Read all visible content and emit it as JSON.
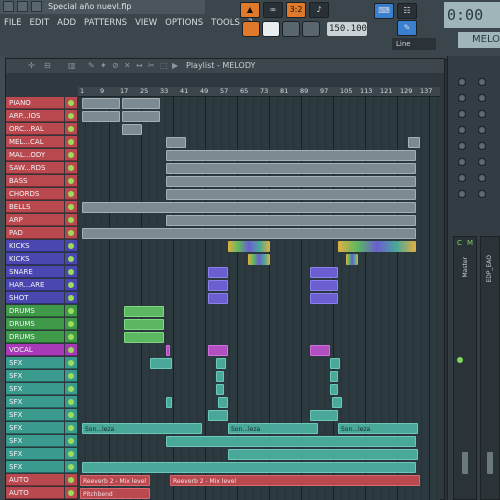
{
  "window": {
    "title": "Special año nuevl.flp"
  },
  "menu": [
    "FILE",
    "EDIT",
    "ADD",
    "PATTERNS",
    "VIEW",
    "OPTIONS",
    "TOOLS",
    "?"
  ],
  "transport": {
    "pattern_label": "PAT",
    "song_label": "SONG",
    "tempo": "150.100",
    "time": "0:00",
    "snap": "Line",
    "pattern_name": "MELO"
  },
  "playlist": {
    "title": "Playlist - MELODY",
    "ruler": [
      "1",
      "9",
      "17",
      "25",
      "33",
      "41",
      "49",
      "57",
      "65",
      "73",
      "81",
      "89",
      "97",
      "105",
      "113",
      "121",
      "129",
      "137"
    ]
  },
  "tracks": [
    {
      "name": "PIANO",
      "color": "#b9484f"
    },
    {
      "name": "ARP...IOS",
      "color": "#b9484f"
    },
    {
      "name": "ORC...RAL",
      "color": "#b9484f"
    },
    {
      "name": "MEL...CAL",
      "color": "#b9484f"
    },
    {
      "name": "MAL...ODY",
      "color": "#b9484f"
    },
    {
      "name": "SAW...RDS",
      "color": "#b9484f"
    },
    {
      "name": "BASS",
      "color": "#b9484f"
    },
    {
      "name": "CHORDS",
      "color": "#b9484f"
    },
    {
      "name": "BELLS",
      "color": "#b9484f"
    },
    {
      "name": "ARP",
      "color": "#b9484f"
    },
    {
      "name": "PAD",
      "color": "#b9484f"
    },
    {
      "name": "KICKS",
      "color": "#4a47b0"
    },
    {
      "name": "KICKS",
      "color": "#4a47b0"
    },
    {
      "name": "SNARE",
      "color": "#4a47b0"
    },
    {
      "name": "HAR...ARE",
      "color": "#4a47b0"
    },
    {
      "name": "SHOT",
      "color": "#4a47b0"
    },
    {
      "name": "DRUMS",
      "color": "#3e9a48"
    },
    {
      "name": "DRUMS",
      "color": "#3e9a48"
    },
    {
      "name": "DRUMS",
      "color": "#3e9a48"
    },
    {
      "name": "VOCAL",
      "color": "#a83ab8"
    },
    {
      "name": "SFX",
      "color": "#3a9a8e"
    },
    {
      "name": "SFX",
      "color": "#3a9a8e"
    },
    {
      "name": "SFX",
      "color": "#3a9a8e"
    },
    {
      "name": "SFX",
      "color": "#3a9a8e"
    },
    {
      "name": "SFX",
      "color": "#3a9a8e"
    },
    {
      "name": "SFX",
      "color": "#3a9a8e"
    },
    {
      "name": "SFX",
      "color": "#3a9a8e"
    },
    {
      "name": "SFX",
      "color": "#3a9a8e"
    },
    {
      "name": "SFX",
      "color": "#3a9a8e"
    },
    {
      "name": "AUTO",
      "color": "#b9484f"
    },
    {
      "name": "AUTO",
      "color": "#b9484f"
    }
  ],
  "clip_text": {
    "son_leza": "Son...leza",
    "reverb": "Reeverb 2 - Mix level",
    "pitch": "Pitchbend"
  },
  "mixer": {
    "master": "Master",
    "insert": "EDP_EAO",
    "label_c": "C",
    "label_m": "M"
  }
}
